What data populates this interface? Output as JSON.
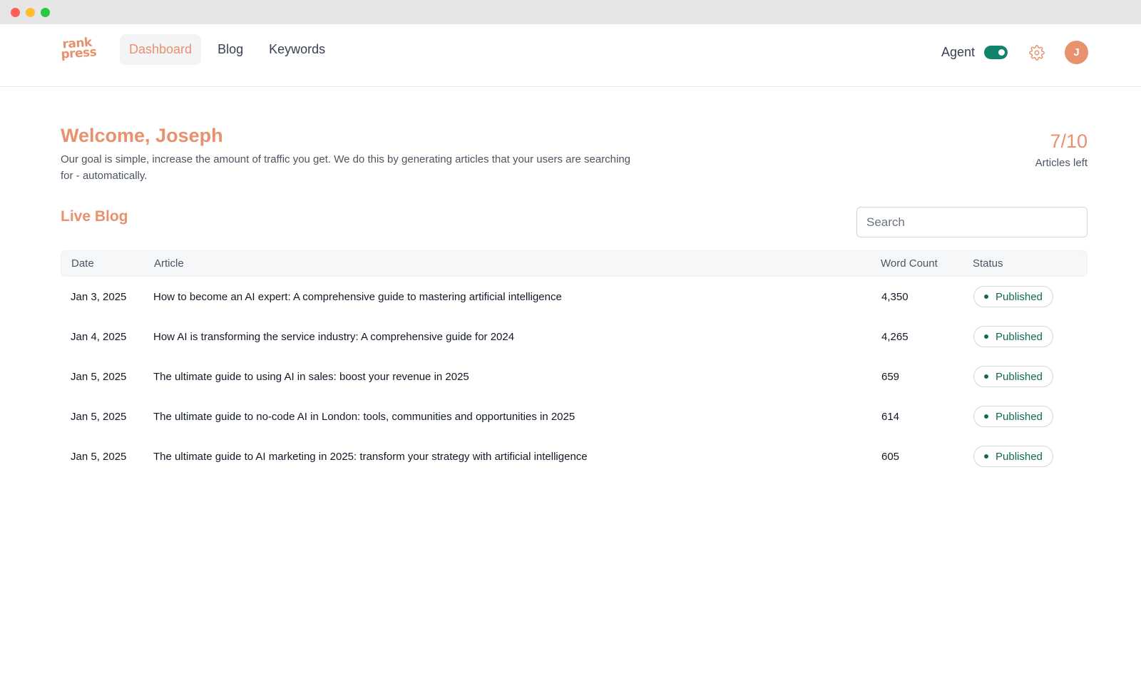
{
  "brand": {
    "logo_line1": "rank",
    "logo_line2": "press",
    "accent_color": "#e8916e",
    "success_color": "#11826b"
  },
  "nav": {
    "links": [
      {
        "label": "Dashboard",
        "active": true
      },
      {
        "label": "Blog",
        "active": false
      },
      {
        "label": "Keywords",
        "active": false
      }
    ],
    "agent_label": "Agent",
    "agent_enabled": true,
    "settings_icon": "gear-icon",
    "avatar_initial": "J"
  },
  "welcome": {
    "title": "Welcome, Joseph",
    "description": "Our goal is simple, increase the amount of traffic you get. We do this by generating articles that your users are searching for - automatically."
  },
  "credits": {
    "count": "7/10",
    "label": "Articles left"
  },
  "live_blog": {
    "title": "Live Blog",
    "search_placeholder": "Search",
    "columns": [
      "Date",
      "Article",
      "Word Count",
      "Status"
    ],
    "rows": [
      {
        "date": "Jan 3, 2025",
        "article": "How to become an AI expert: A comprehensive guide to mastering artificial intelligence",
        "word_count": "4,350",
        "status": "Published"
      },
      {
        "date": "Jan 4, 2025",
        "article": "How AI is transforming the service industry: A comprehensive guide for 2024",
        "word_count": "4,265",
        "status": "Published"
      },
      {
        "date": "Jan 5, 2025",
        "article": "The ultimate guide to using AI in sales: boost your revenue in 2025",
        "word_count": "659",
        "status": "Published"
      },
      {
        "date": "Jan 5, 2025",
        "article": "The ultimate guide to no-code AI in London: tools, communities and opportunities in 2025",
        "word_count": "614",
        "status": "Published"
      },
      {
        "date": "Jan 5, 2025",
        "article": "The ultimate guide to AI marketing in 2025: transform your strategy with artificial intelligence",
        "word_count": "605",
        "status": "Published"
      }
    ]
  }
}
